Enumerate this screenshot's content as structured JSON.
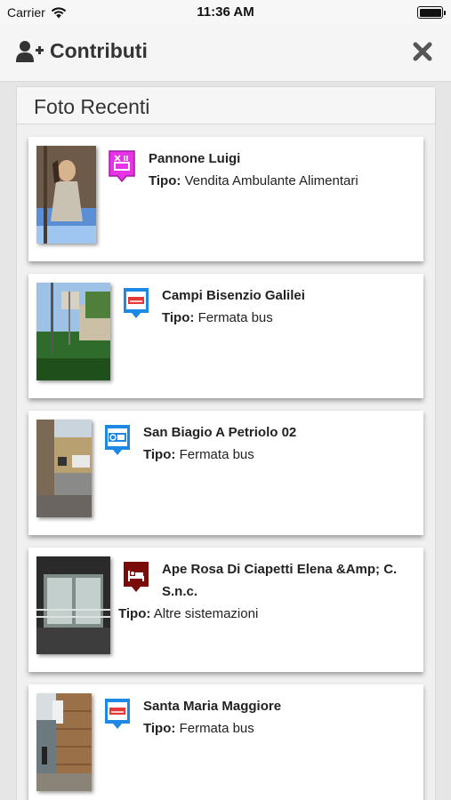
{
  "status_bar": {
    "carrier": "Carrier",
    "time": "11:36 AM"
  },
  "header": {
    "title": "Contributi"
  },
  "panel": {
    "heading": "Foto Recenti"
  },
  "labels": {
    "tipo": "Tipo:"
  },
  "items": [
    {
      "name": "Pannone Luigi",
      "tipo": "Vendita Ambulante Alimentari",
      "icon": "food-truck-icon",
      "color": "#e633e6"
    },
    {
      "name": "Campi Bisenzio Galilei",
      "tipo": "Fermata bus",
      "icon": "bus-stop-icon",
      "color": "#1e88e5"
    },
    {
      "name": "San Biagio A Petriolo 02",
      "tipo": "Fermata bus",
      "icon": "cap-bus-icon",
      "color": "#1e88e5"
    },
    {
      "name": "Ape Rosa Di Ciapetti Elena &Amp; C. S.n.c.",
      "tipo": "Altre sistemazioni",
      "icon": "bed-icon",
      "color": "#7a0b0b"
    },
    {
      "name": "Santa Maria Maggiore",
      "tipo": "Fermata bus",
      "icon": "bus-stop-icon",
      "color": "#1e88e5"
    }
  ]
}
